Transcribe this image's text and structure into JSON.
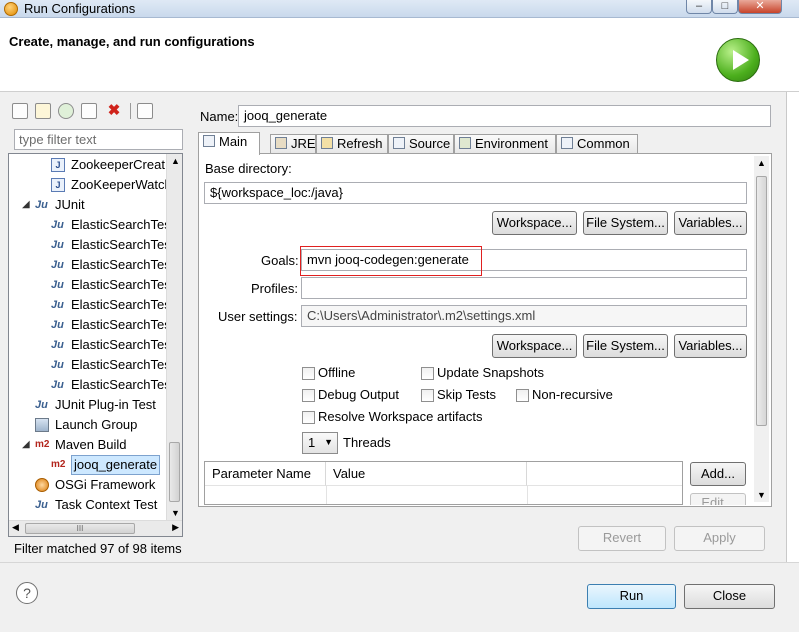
{
  "window": {
    "title": "Run Configurations"
  },
  "header": {
    "title": "Create, manage, and run configurations"
  },
  "left": {
    "filter_placeholder": "type filter text",
    "tree": [
      {
        "label": "ZookeeperCreat",
        "icon": "java-file-icon",
        "indent": 2
      },
      {
        "label": "ZooKeeperWatcl",
        "icon": "java-file-icon",
        "indent": 2
      },
      {
        "label": "JUnit",
        "icon": "junit-icon",
        "indent": 1,
        "expander": "◢"
      },
      {
        "label": "ElasticSearchTes",
        "icon": "junit-icon",
        "indent": 2
      },
      {
        "label": "ElasticSearchTes",
        "icon": "junit-icon",
        "indent": 2
      },
      {
        "label": "ElasticSearchTes",
        "icon": "junit-icon",
        "indent": 2
      },
      {
        "label": "ElasticSearchTes",
        "icon": "junit-icon",
        "indent": 2
      },
      {
        "label": "ElasticSearchTes",
        "icon": "junit-icon",
        "indent": 2
      },
      {
        "label": "ElasticSearchTes",
        "icon": "junit-icon",
        "indent": 2
      },
      {
        "label": "ElasticSearchTes",
        "icon": "junit-icon",
        "indent": 2
      },
      {
        "label": "ElasticSearchTes",
        "icon": "junit-icon",
        "indent": 2
      },
      {
        "label": "ElasticSearchTes",
        "icon": "junit-icon",
        "indent": 2
      },
      {
        "label": "JUnit Plug-in Test",
        "icon": "junit-plugin-icon",
        "indent": 1
      },
      {
        "label": "Launch Group",
        "icon": "launch-group-icon",
        "indent": 1
      },
      {
        "label": "Maven Build",
        "icon": "maven-icon",
        "indent": 1,
        "expander": "◢"
      },
      {
        "label": "jooq_generate",
        "icon": "maven-icon",
        "indent": 2,
        "selected": true
      },
      {
        "label": "OSGi Framework",
        "icon": "osgi-icon",
        "indent": 1
      },
      {
        "label": "Task Context Test",
        "icon": "junit-icon",
        "indent": 1
      }
    ],
    "hscroll_glyph": "III",
    "filter_status": "Filter matched 97 of 98 items"
  },
  "config": {
    "name_label": "Name:",
    "name_value": "jooq_generate",
    "tabs": [
      {
        "label": "Main",
        "icon": "main-tab-icon",
        "active": true
      },
      {
        "label": "JRE",
        "icon": "jre-tab-icon"
      },
      {
        "label": "Refresh",
        "icon": "refresh-tab-icon"
      },
      {
        "label": "Source",
        "icon": "source-tab-icon"
      },
      {
        "label": "Environment",
        "icon": "environment-tab-icon"
      },
      {
        "label": "Common",
        "icon": "common-tab-icon"
      }
    ],
    "base_directory_label": "Base directory:",
    "base_directory_value": "${workspace_loc:/java}",
    "workspace_btn": "Workspace...",
    "filesystem_btn": "File System...",
    "variables_btn": "Variables...",
    "goals_label": "Goals:",
    "goals_value": "mvn jooq-codegen:generate",
    "profiles_label": "Profiles:",
    "profiles_value": "",
    "user_settings_label": "User settings:",
    "user_settings_value": "C:\\Users\\Administrator\\.m2\\settings.xml",
    "checkboxes": {
      "offline": "Offline",
      "update_snapshots": "Update Snapshots",
      "debug_output": "Debug Output",
      "skip_tests": "Skip Tests",
      "non_recursive": "Non-recursive",
      "resolve_workspace": "Resolve Workspace artifacts"
    },
    "threads_value": "1",
    "threads_label": "Threads",
    "param_name_header": "Parameter Name",
    "value_header": "Value",
    "add_btn": "Add...",
    "edit_btn": "Edit..."
  },
  "actions": {
    "revert": "Revert",
    "apply": "Apply",
    "run": "Run",
    "close": "Close",
    "help": "?"
  },
  "colors": {
    "highlight": "#e02020",
    "selection": "#cde8ff",
    "run_green": "#4caf1d"
  }
}
